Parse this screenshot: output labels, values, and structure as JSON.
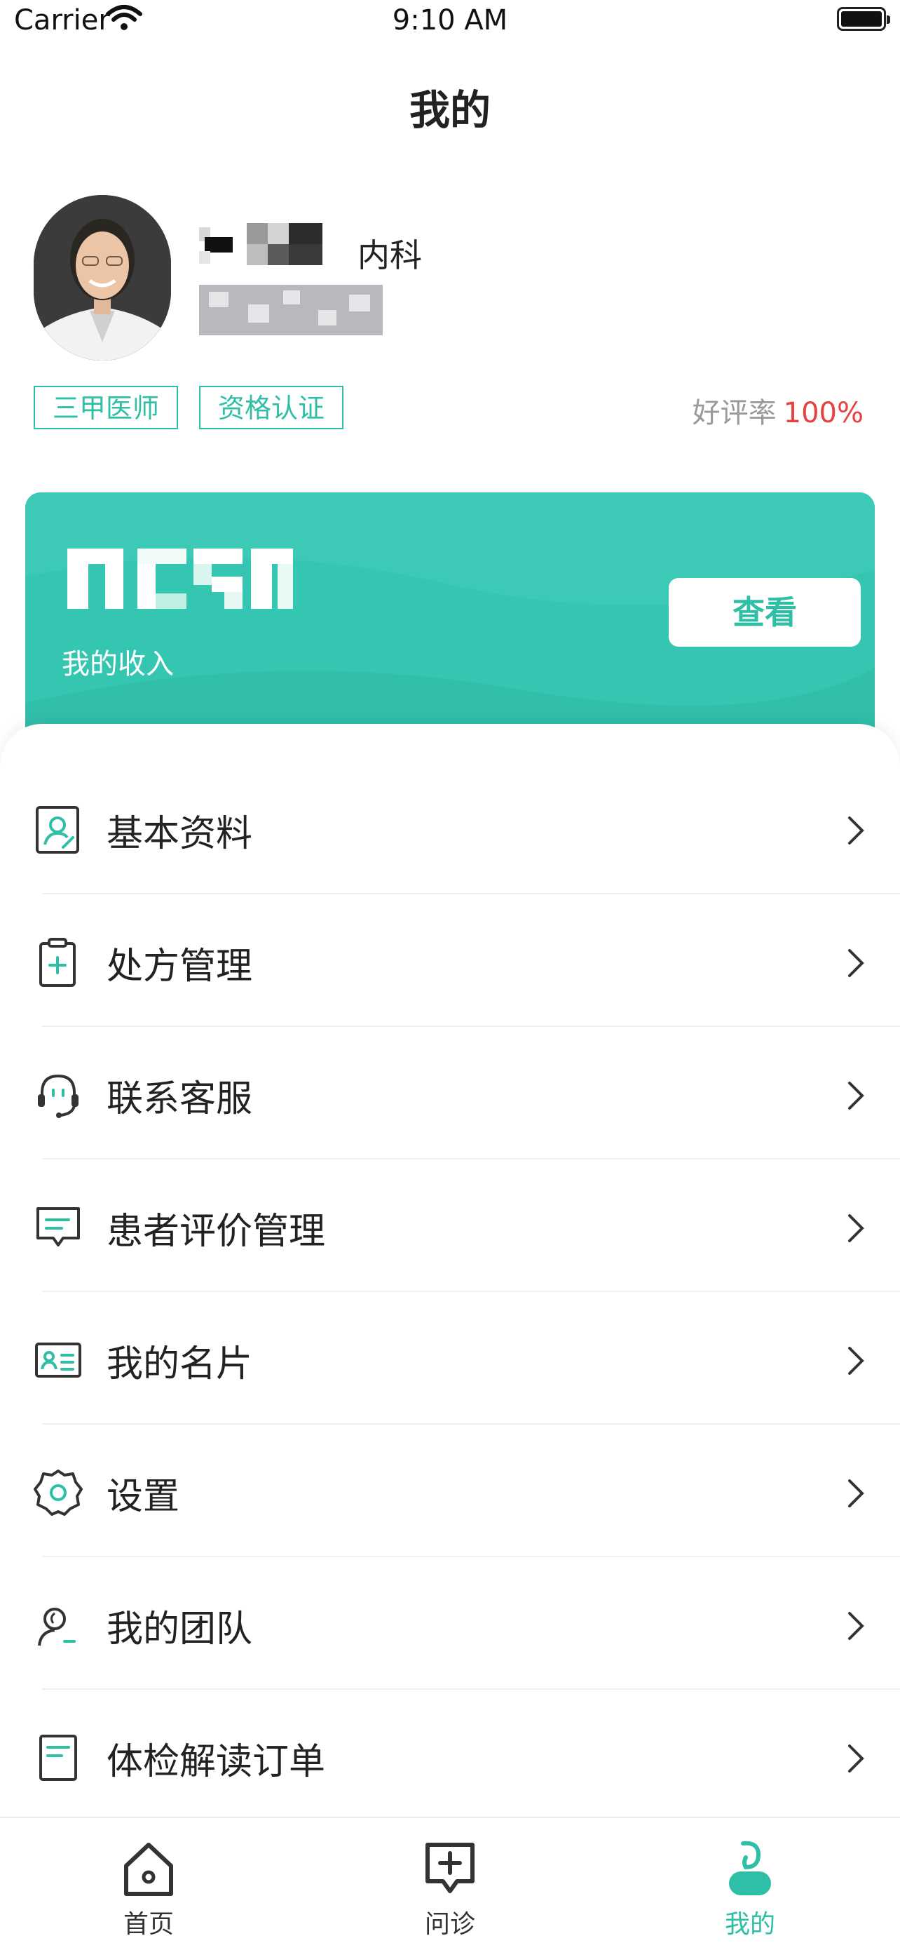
{
  "status_bar": {
    "carrier": "Carrier",
    "time": "9:10 AM"
  },
  "header": {
    "title": "我的"
  },
  "profile": {
    "department": "内科",
    "tags": [
      "三甲医师",
      "资格认证"
    ],
    "rating_label": "好评率",
    "rating_value": "100%"
  },
  "income": {
    "label": "我的收入",
    "view_button": "查看"
  },
  "menu": {
    "items": [
      {
        "label": "基本资料",
        "icon": "profile-card-icon"
      },
      {
        "label": "处方管理",
        "icon": "prescription-icon"
      },
      {
        "label": "联系客服",
        "icon": "headset-icon"
      },
      {
        "label": "患者评价管理",
        "icon": "comment-icon"
      },
      {
        "label": "我的名片",
        "icon": "business-card-icon"
      },
      {
        "label": "设置",
        "icon": "gear-icon"
      },
      {
        "label": "我的团队",
        "icon": "team-icon"
      },
      {
        "label": "体检解读订单",
        "icon": "document-icon"
      }
    ]
  },
  "tabbar": {
    "items": [
      {
        "label": "首页",
        "icon": "home-icon"
      },
      {
        "label": "问诊",
        "icon": "consult-icon"
      },
      {
        "label": "我的",
        "icon": "mine-icon",
        "active": true
      }
    ]
  },
  "colors": {
    "accent": "#2fbfa6",
    "card": "#35c6b1",
    "rating": "#e8423e"
  }
}
